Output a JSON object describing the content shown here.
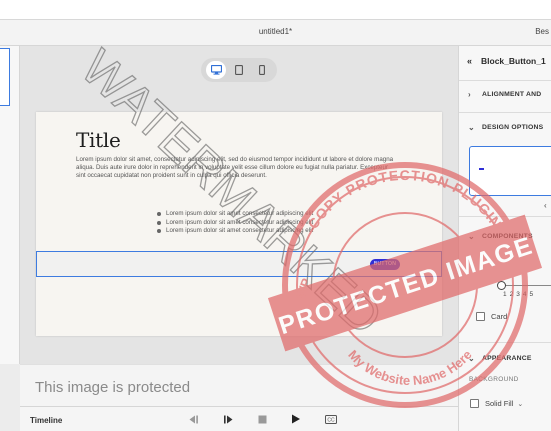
{
  "app": {
    "document_title": "untitled1*",
    "top_right_text": "Bes"
  },
  "canvas": {
    "device_modes": [
      "desktop-icon",
      "tablet-icon",
      "mobile-icon"
    ],
    "active_device": "desktop"
  },
  "page": {
    "title": "Title",
    "paragraph": "Lorem ipsum dolor sit amet, consectetur adipiscing elit, sed do eiusmod tempor incididunt ut labore et dolore magna aliqua. Duis aute irure dolor in reprehenderit in voluptate velit esse cillum dolore eu fugiat nulla pariatur. Excepteur sint occaecat cupidatat non proident sunt in culpa qui officia deserunt.",
    "list_items": [
      "Lorem ipsum dolor sit amet consectetur adipiscing elit",
      "Lorem ipsum dolor sit amet consectetur adipiscing elit",
      "Lorem ipsum dolor sit amet consectetur adipiscing elit"
    ],
    "button_label": "BUTTON"
  },
  "right_panel": {
    "block_name": "Block_Button_1",
    "section_alignment": "ALIGNMENT AND",
    "section_design": "DESIGN OPTIONS",
    "section_components": "COMPONENTS",
    "slider_ticks": [
      "1",
      "2",
      "3",
      "4",
      "5"
    ],
    "card_label": "Card",
    "section_appearance": "APPEARANCE",
    "background_label": "BACKGROUND",
    "fill_label": "Solid Fill"
  },
  "overlay": {
    "protected_text": "This image is protected",
    "watermark_text": "WATERMARKED",
    "stamp_text": "COPY PROTECTION PLUGIN",
    "stamp_center": "PROTECTED IMAGE",
    "stamp_bottom": "My Website Name Here",
    "stamp_left": "WP"
  },
  "timeline": {
    "label": "Timeline"
  },
  "colors": {
    "accent": "#3d7be0",
    "button": "#2f2fd6",
    "stamp": "#e06a6a"
  }
}
